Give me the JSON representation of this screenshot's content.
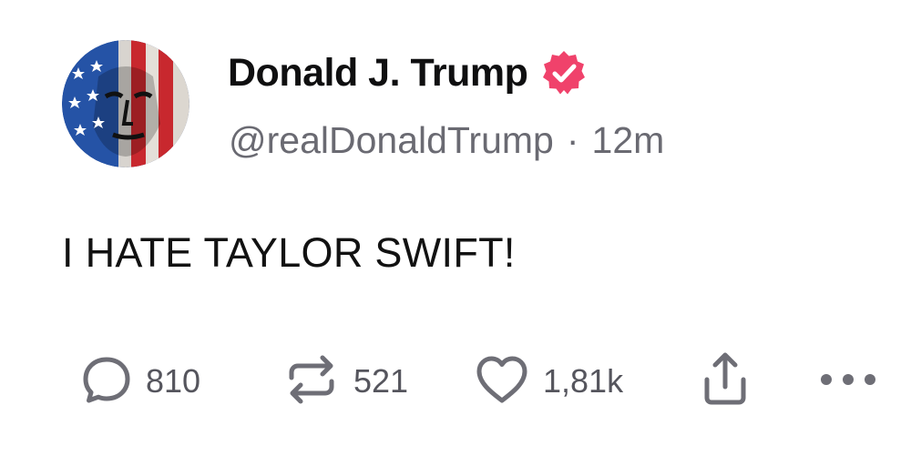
{
  "author": {
    "display_name": "Donald J. Trump",
    "handle": "@realDonaldTrump",
    "separator": "·",
    "time_ago": "12m",
    "verified": true,
    "verified_color": "#f0426b"
  },
  "post": {
    "text": "I HATE TAYLOR SWIFT!"
  },
  "actions": {
    "reply_count": "810",
    "repost_count": "521",
    "like_count": "1,81k",
    "icon_color": "#6e6e76",
    "icons": [
      "reply-icon",
      "repost-icon",
      "like-icon",
      "share-icon",
      "more-icon"
    ]
  }
}
